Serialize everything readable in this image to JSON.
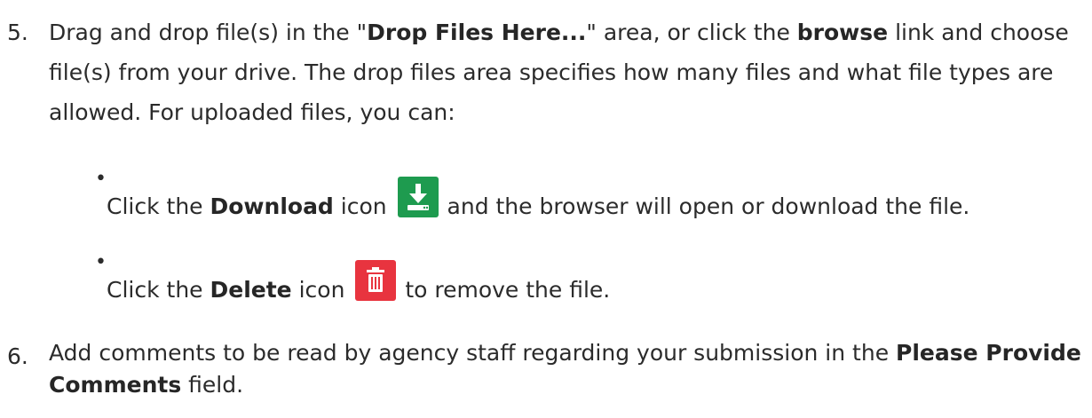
{
  "steps": [
    {
      "number": "5.",
      "t1": "Drag and drop file(s) in the \"",
      "b1": "Drop Files Here...",
      "t2": "\" area, or click the ",
      "b2": "browse",
      "t3": " link and choose file(s) from your drive. The drop files area specifies how many files and what file types are allowed. For uploaded files, you can:"
    },
    {
      "number": "6.",
      "t1": "Add comments to be read by agency staff regarding your submission in the ",
      "b1": "Please Provide Comments",
      "t2": " field."
    }
  ],
  "bullets": [
    {
      "dot": "•",
      "t1": "Click the ",
      "b1": "Download",
      "t2": " icon",
      "t3": " and the browser will open or download the file.",
      "icon": "download-icon"
    },
    {
      "dot": "•",
      "t1": "Click the ",
      "b1": "Delete",
      "t2": " icon",
      "t3": " to remove the file.",
      "icon": "trash-icon"
    }
  ],
  "colors": {
    "download_icon_bg": "#1e9b4f",
    "delete_icon_bg": "#e8343f",
    "text": "#2b2b2b"
  }
}
